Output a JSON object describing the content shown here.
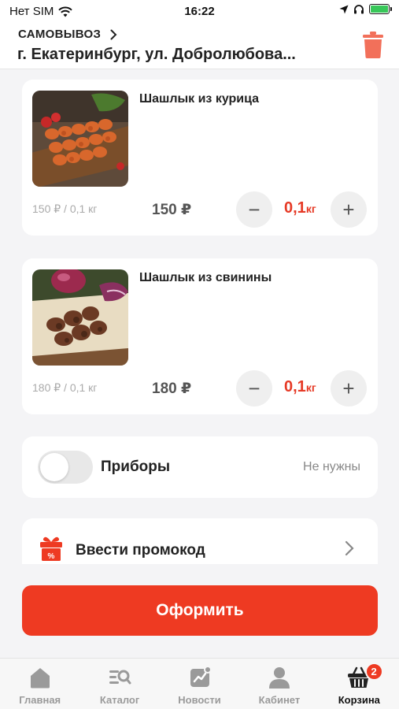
{
  "status_bar": {
    "carrier": "Нет SIM",
    "time": "16:22"
  },
  "header": {
    "pickup_label": "САМОВЫВОЗ",
    "address": "г. Екатеринбург, ул. Добролюбова..."
  },
  "cart": {
    "items": [
      {
        "name": "Шашлык из курица",
        "unit_price": "150 ₽ / 0,1 кг",
        "total_price": "150 ₽",
        "quantity": "0,1",
        "unit": "кг"
      },
      {
        "name": "Шашлык из свинины",
        "unit_price": "180 ₽ / 0,1 кг",
        "total_price": "180 ₽",
        "quantity": "0,1",
        "unit": "кг"
      }
    ],
    "utensils": {
      "label": "Приборы",
      "status": "Не нужны",
      "enabled": false
    },
    "promo": {
      "label": "Ввести промокод"
    },
    "checkout_label": "Оформить"
  },
  "tabbar": {
    "tabs": [
      {
        "label": "Главная",
        "icon": "home-icon"
      },
      {
        "label": "Каталог",
        "icon": "catalog-icon"
      },
      {
        "label": "Новости",
        "icon": "news-icon"
      },
      {
        "label": "Кабинет",
        "icon": "profile-icon"
      },
      {
        "label": "Корзина",
        "icon": "basket-icon",
        "active": true,
        "badge": "2"
      }
    ]
  },
  "colors": {
    "accent": "#ee3a22",
    "quantity": "#e63a26"
  }
}
